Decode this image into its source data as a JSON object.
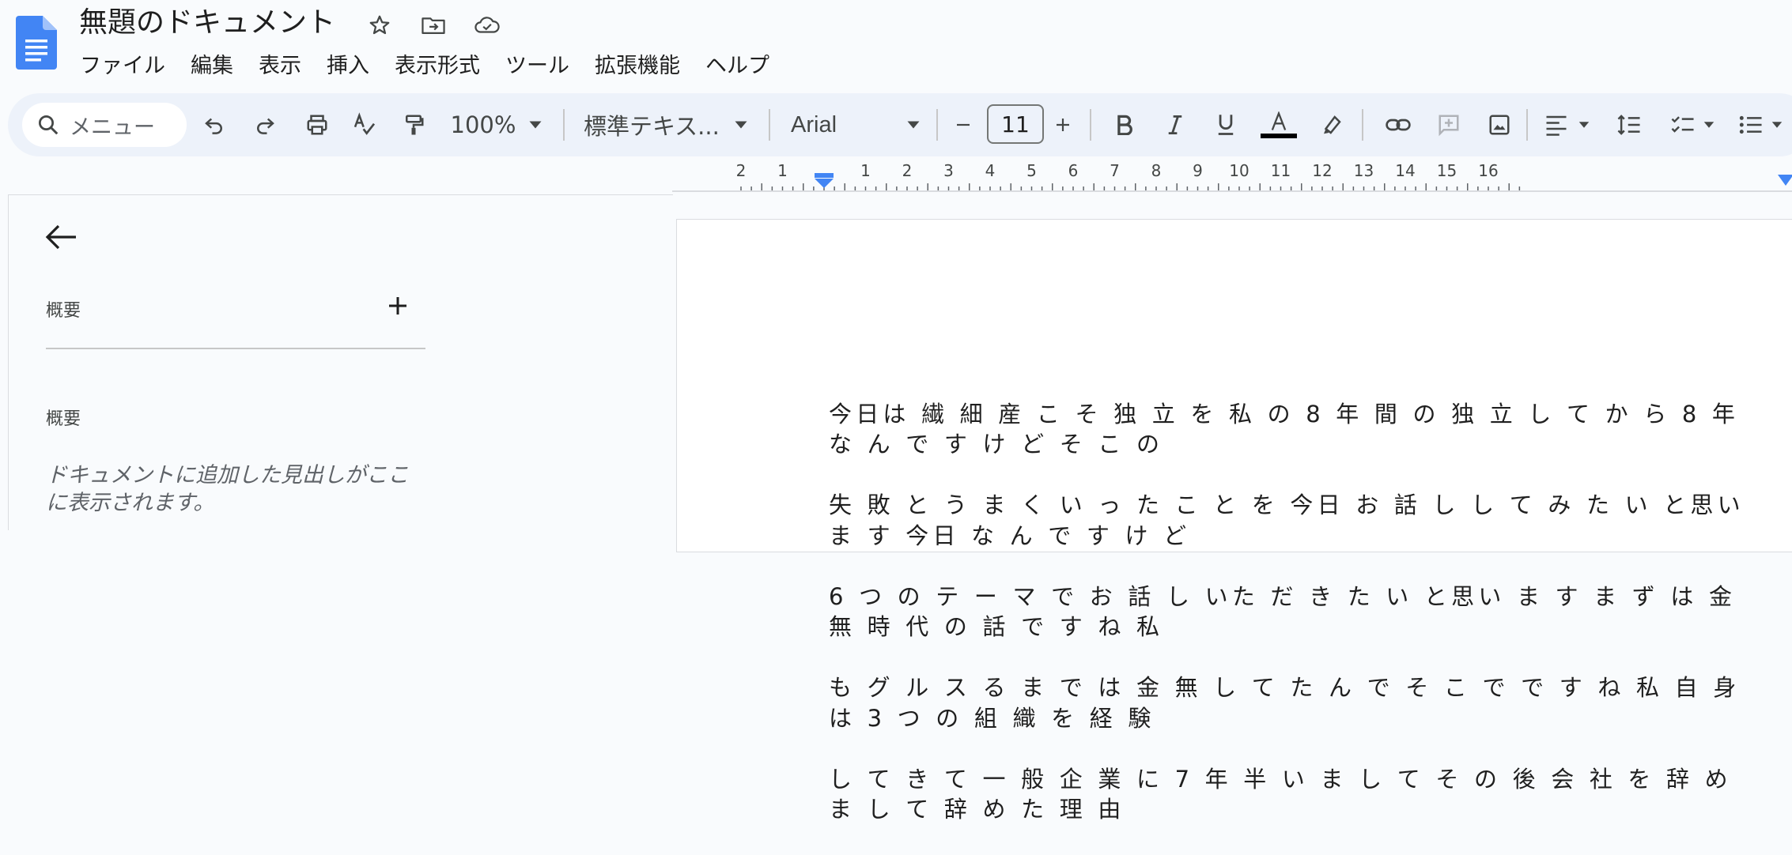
{
  "document": {
    "title": "無題のドキュメント"
  },
  "menu": [
    "ファイル",
    "編集",
    "表示",
    "挿入",
    "表示形式",
    "ツール",
    "拡張機能",
    "ヘルプ"
  ],
  "toolbar": {
    "search_placeholder": "メニュー",
    "zoom": "100%",
    "style": "標準テキス...",
    "font": "Arial",
    "font_size": "11",
    "text_color": "#000000"
  },
  "ruler": {
    "labels": [
      "2",
      "1",
      "1",
      "2",
      "3",
      "4",
      "5",
      "6",
      "7",
      "8",
      "9",
      "10",
      "11",
      "12",
      "13",
      "14",
      "15",
      "16"
    ]
  },
  "outline": {
    "summary_header": "概要",
    "outline_header": "概要",
    "hint": "ドキュメントに追加した見出しがここに表示されます。"
  },
  "body": {
    "lines": [
      "今日は 繊 細 産 こ そ 独 立 を 私 の 8 年 間 の 独 立 し て か ら 8 年 な ん で す け ど そ こ の",
      "失 敗 と う ま く い っ た こ と を 今日 お 話 し し て み た い と思い ま す 今日 な ん で す け ど",
      "6 つ の テ ー マ で お 話 し いた だ き た い と思い ま す ま ず は 金 無 時 代 の 話 で す ね 私",
      "も グ ル ス る ま で は 金 無 し て た ん で そ こ で で す ね 私 自 身 は 3 つ の 組 織 を 経 験",
      "し て き て 一 般 企 業 に 7 年 半 い ま し て そ の 後 会 社 を 辞 め ま し て 辞 め た 理 由"
    ]
  },
  "colors": {
    "accent": "#4285f4",
    "toolbar_bg": "#edf2fa"
  }
}
